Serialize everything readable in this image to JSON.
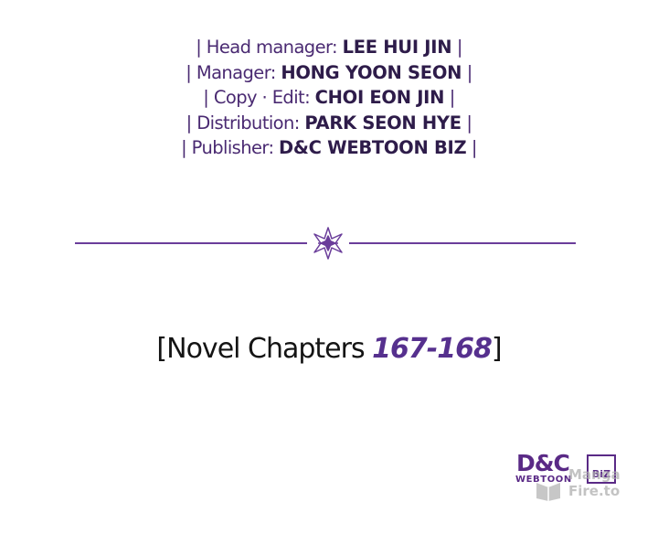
{
  "credits": [
    {
      "role": "| Head manager: ",
      "name": "LEE HUI JIN",
      "end": " |"
    },
    {
      "role": "| Manager: ",
      "name": "HONG YOON SEON",
      "end": " |"
    },
    {
      "role": "| Copy · Edit: ",
      "name": "CHOI EON JIN",
      "end": " |"
    },
    {
      "role": "| Distribution: ",
      "name": "PARK SEON HYE",
      "end": " |"
    },
    {
      "role": "| Publisher: ",
      "name": "D&C WEBTOON BIZ",
      "end": " |"
    }
  ],
  "chapters": {
    "open": "[",
    "label": "Novel Chapters ",
    "range": "167-168",
    "close": "]"
  },
  "logo": {
    "top": "D&C",
    "bottom": "WEBTOON",
    "box": "BiZ"
  },
  "watermark": {
    "line1": "Manga",
    "line2": "Fire.to"
  },
  "colors": {
    "accent": "#56308e",
    "credit_text": "#4a2a72",
    "divider": "#6a3d9a",
    "logo": "#5a2a86"
  }
}
